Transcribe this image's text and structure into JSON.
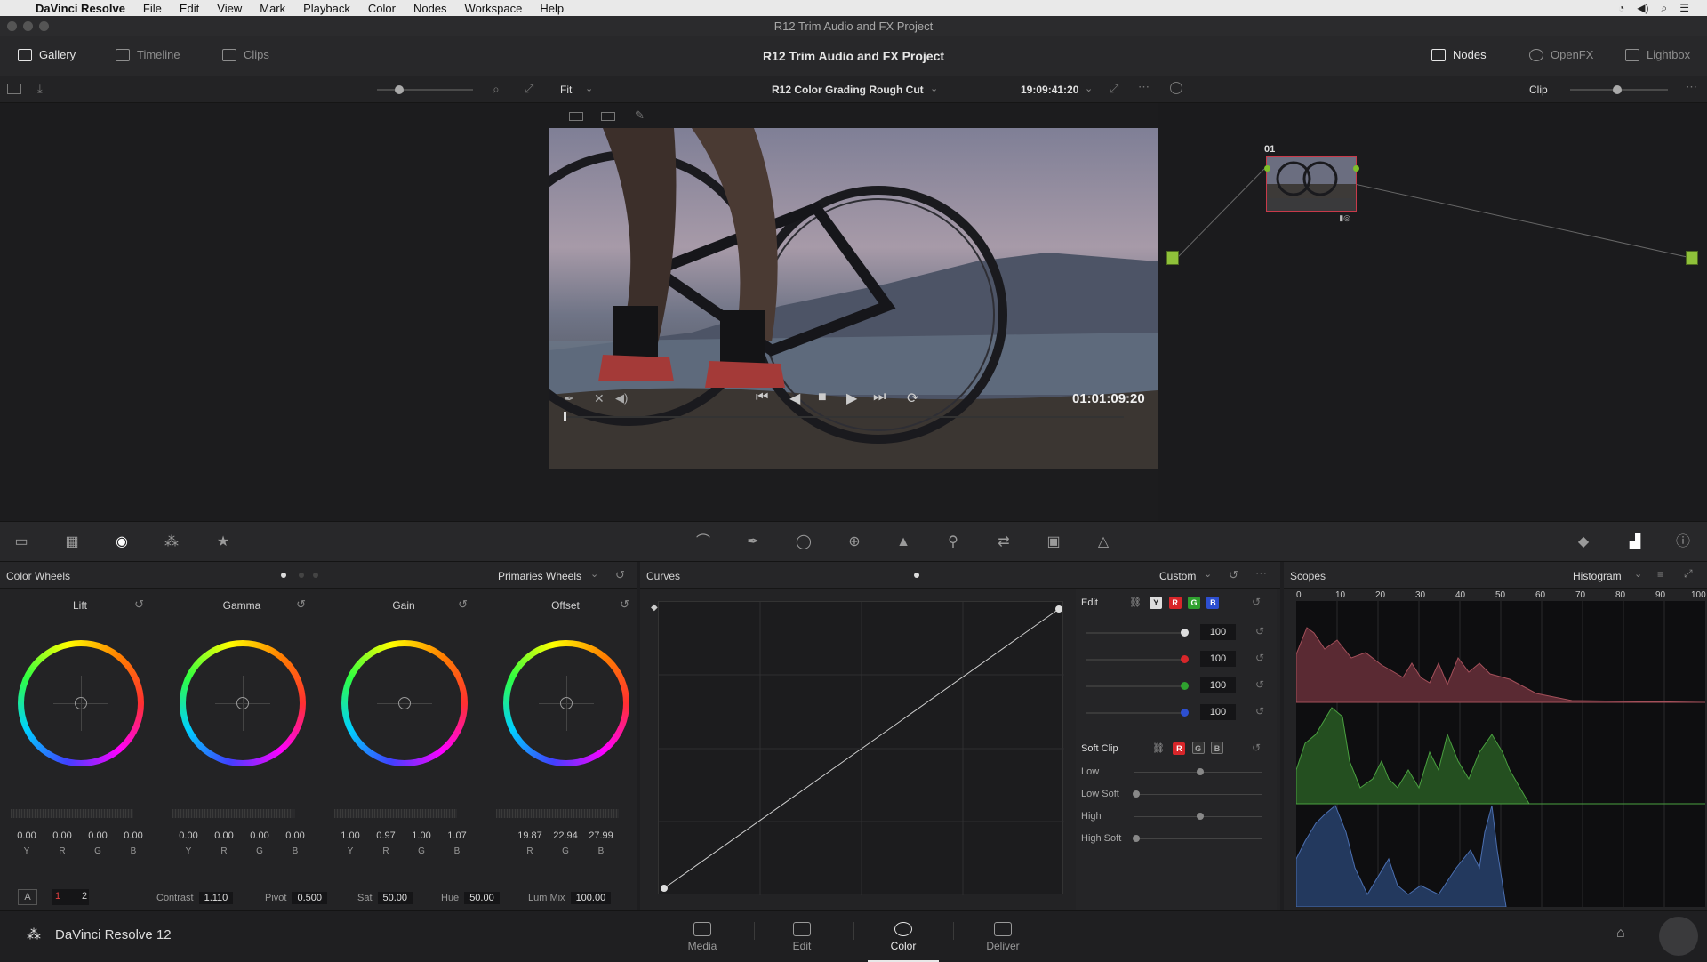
{
  "menubar": {
    "app_name": "DaVinci Resolve",
    "items": [
      "File",
      "Edit",
      "View",
      "Mark",
      "Playback",
      "Color",
      "Nodes",
      "Workspace",
      "Help"
    ]
  },
  "window": {
    "title": "R12 Trim Audio and FX Project"
  },
  "topbar": {
    "gallery": "Gallery",
    "timeline": "Timeline",
    "clips": "Clips",
    "project_title": "R12 Trim Audio and FX Project",
    "nodes": "Nodes",
    "openfx": "OpenFX",
    "lightbox": "Lightbox"
  },
  "viewerbar": {
    "fit": "Fit",
    "timeline_name": "R12 Color Grading Rough Cut",
    "timecode": "19:09:41:20",
    "clip_mode": "Clip"
  },
  "viewer": {
    "playhead_timecode": "01:01:09:20"
  },
  "nodes": {
    "node_label": "01"
  },
  "color_wheels": {
    "title": "Color Wheels",
    "mode": "Primaries Wheels",
    "wheels": [
      {
        "name": "Lift",
        "values": [
          "0.00",
          "0.00",
          "0.00",
          "0.00"
        ],
        "labels": [
          "Y",
          "R",
          "G",
          "B"
        ]
      },
      {
        "name": "Gamma",
        "values": [
          "0.00",
          "0.00",
          "0.00",
          "0.00"
        ],
        "labels": [
          "Y",
          "R",
          "G",
          "B"
        ]
      },
      {
        "name": "Gain",
        "values": [
          "1.00",
          "0.97",
          "1.00",
          "1.07"
        ],
        "labels": [
          "Y",
          "R",
          "G",
          "B"
        ]
      },
      {
        "name": "Offset",
        "values": [
          "19.87",
          "22.94",
          "27.99"
        ],
        "labels": [
          "R",
          "G",
          "B"
        ]
      }
    ],
    "footer": {
      "a": "A",
      "page1": "1",
      "page2": "2",
      "contrast_label": "Contrast",
      "contrast": "1.110",
      "pivot_label": "Pivot",
      "pivot": "0.500",
      "sat_label": "Sat",
      "sat": "50.00",
      "hue_label": "Hue",
      "hue": "50.00",
      "lummix_label": "Lum Mix",
      "lummix": "100.00"
    }
  },
  "curves": {
    "title": "Curves",
    "mode": "Custom",
    "edit_label": "Edit",
    "edit_chips": [
      "Y",
      "R",
      "G",
      "B"
    ],
    "edit_values": [
      "100",
      "100",
      "100",
      "100"
    ],
    "soft_clip_label": "Soft Clip",
    "soft_chips": [
      "R",
      "G",
      "B"
    ],
    "soft_rows": [
      "Low",
      "Low Soft",
      "High",
      "High Soft"
    ]
  },
  "scopes": {
    "title": "Scopes",
    "mode": "Histogram",
    "ticks": [
      "0",
      "10",
      "20",
      "30",
      "40",
      "50",
      "60",
      "70",
      "80",
      "90",
      "100"
    ]
  },
  "bottombar": {
    "brand": "DaVinci Resolve 12",
    "pages": [
      "Media",
      "Edit",
      "Color",
      "Deliver"
    ],
    "active_page": "Color"
  },
  "colors": {
    "red": "#d8262a",
    "green": "#2fa12f",
    "blue": "#2d4fd0",
    "hist_red": "#6a2d35",
    "hist_green": "#2c6a26",
    "hist_blue": "#2a4a7d"
  }
}
